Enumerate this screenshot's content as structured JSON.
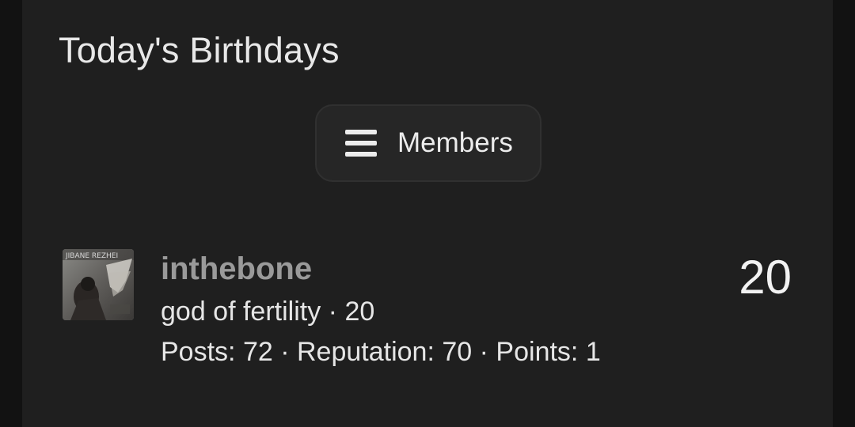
{
  "section": {
    "title": "Today's Birthdays"
  },
  "members_button": {
    "label": "Members",
    "icon": "menu-icon"
  },
  "birthdays": [
    {
      "username": "inthebone",
      "title": "god of fertility",
      "separator": "·",
      "age": "20",
      "stats": {
        "posts_label": "Posts:",
        "posts": "72",
        "reputation_label": "Reputation:",
        "reputation": "70",
        "points_label": "Points:",
        "points": "1"
      },
      "age_display": "20",
      "avatar_text": "JIBANE REZHEI"
    }
  ]
}
